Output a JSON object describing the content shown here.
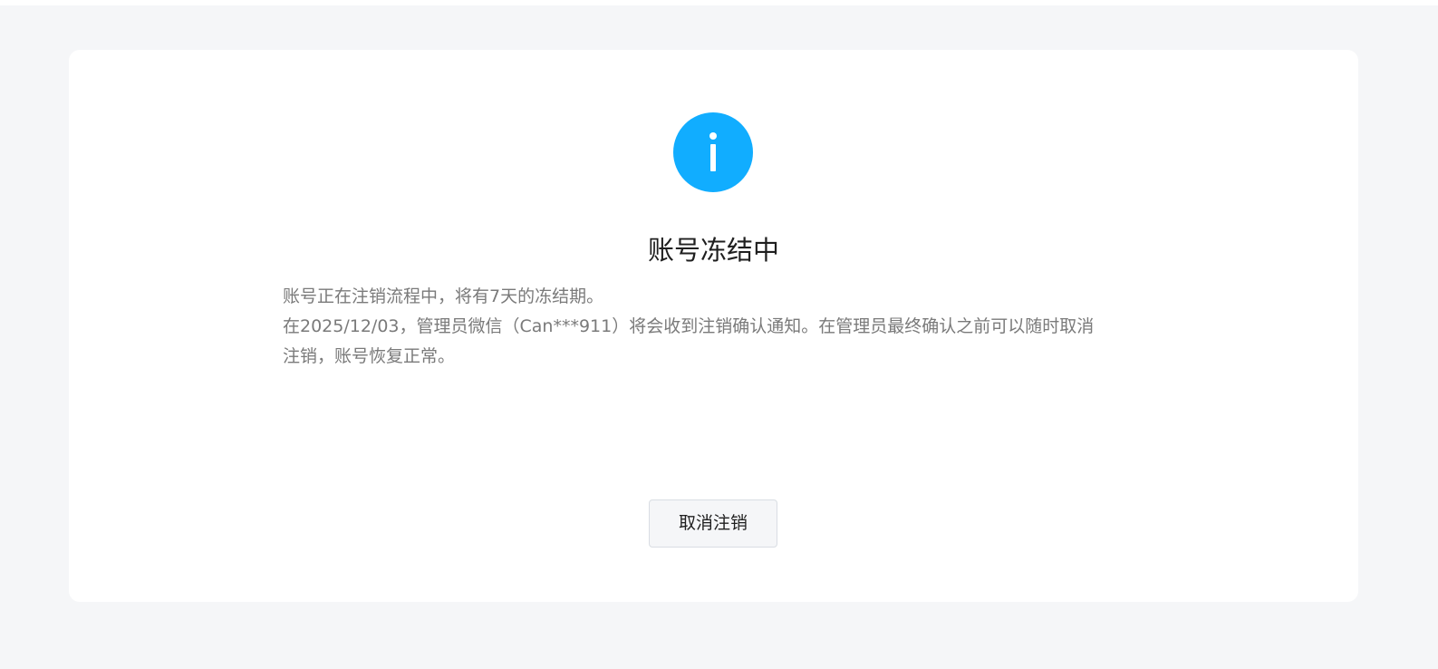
{
  "status": {
    "icon": "info-icon",
    "icon_color": "#11adff",
    "title": "账号冻结中"
  },
  "description": {
    "line1": "账号正在注销流程中，将有7天的冻结期。",
    "line2": "在2025/12/03，管理员微信（Can***911）将会收到注销确认通知。在管理员最终确认之前可以随时取消注销，账号恢复正常。"
  },
  "actions": {
    "cancel_label": "取消注销"
  },
  "colors": {
    "page_background": "#f5f6f8",
    "card_background": "#ffffff",
    "title_text": "#1f1f1f",
    "body_text": "#7a7a7a"
  }
}
